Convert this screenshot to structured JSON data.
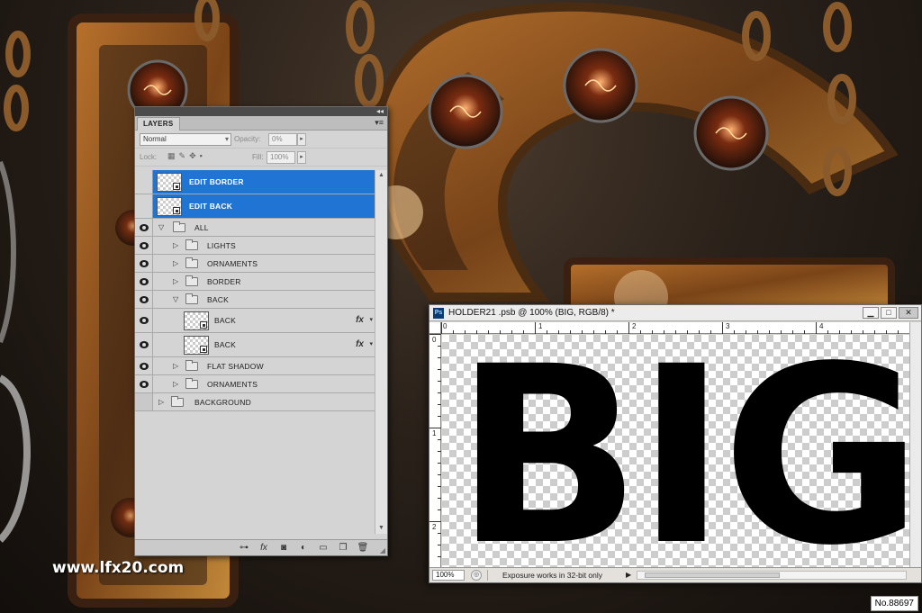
{
  "layers_panel": {
    "tab_label": "LAYERS",
    "collapse_glyph": "◂◂",
    "menu_glyph": "▾≡",
    "blend_mode": "Normal",
    "opacity_label": "Opacity:",
    "opacity_value": "0%",
    "lock_label": "Lock:",
    "fill_label": "Fill:",
    "fill_value": "100%",
    "layers": [
      {
        "name": "EDIT BORDER",
        "visible": false,
        "selected": true,
        "kind": "smart"
      },
      {
        "name": "EDIT BACK",
        "visible": false,
        "selected": true,
        "kind": "smart"
      },
      {
        "name": "ALL",
        "visible": true,
        "kind": "group",
        "expanded": true
      },
      {
        "name": "LIGHTS",
        "visible": true,
        "kind": "group"
      },
      {
        "name": "ORNAMENTS",
        "visible": true,
        "kind": "group"
      },
      {
        "name": "BORDER",
        "visible": true,
        "kind": "group"
      },
      {
        "name": "BACK",
        "visible": true,
        "kind": "group",
        "expanded": true
      },
      {
        "name": "BACK",
        "visible": true,
        "kind": "smart",
        "fx": "fx"
      },
      {
        "name": "BACK",
        "visible": true,
        "kind": "smart",
        "fx": "fx"
      },
      {
        "name": "FLAT SHADOW",
        "visible": true,
        "kind": "group"
      },
      {
        "name": "ORNAMENTS",
        "visible": true,
        "kind": "group"
      },
      {
        "name": "BACKGROUND",
        "visible": false,
        "kind": "group"
      }
    ],
    "footer_icons": [
      "link-icon",
      "fx-icon",
      "mask-icon",
      "adjustment-icon",
      "folder-icon",
      "new-layer-icon",
      "trash-icon"
    ]
  },
  "document": {
    "app_badge": "Ps",
    "title": "HOLDER21 .psb @ 100% (BIG, RGB/8) *",
    "minimize": "▁",
    "maximize": "□",
    "close": "✕",
    "ruler_h_labels": [
      "0",
      "1",
      "2",
      "3",
      "4"
    ],
    "ruler_v_labels": [
      "0",
      "1",
      "2"
    ],
    "canvas_text": "BIG",
    "zoom": "100%",
    "status_text": "Exposure works in 32-bit only",
    "status_arrow": "▶"
  },
  "watermark": "www.lfx20.com",
  "id_badge": "No.88697"
}
